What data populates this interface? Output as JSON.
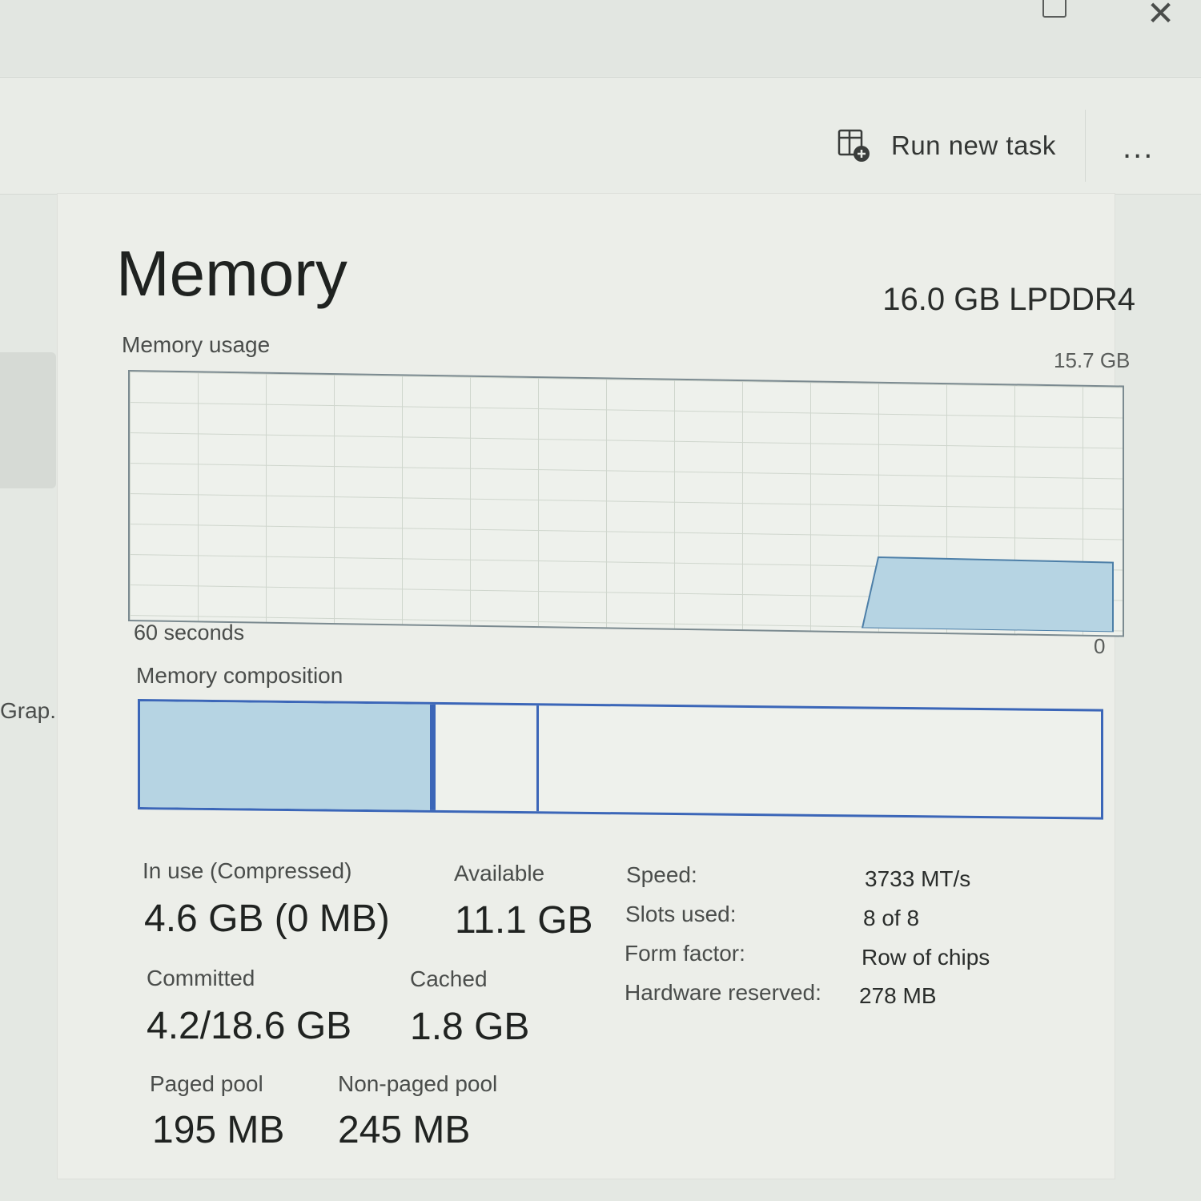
{
  "toolbar": {
    "run_new_task_label": "Run new task",
    "more_label": "..."
  },
  "sidebar": {
    "partial_item_label": "Grap..."
  },
  "memory": {
    "title": "Memory",
    "type": "16.0 GB LPDDR4",
    "usage": {
      "label": "Memory usage",
      "max_label": "15.7 GB",
      "time_span_label": "60 seconds",
      "min_label": "0",
      "recent_fraction": 0.29
    },
    "composition": {
      "label": "Memory composition",
      "in_use_fraction": 0.3,
      "standby_fraction": 0.11
    },
    "stats": {
      "in_use_label": "In use (Compressed)",
      "in_use_value": "4.6 GB (0 MB)",
      "available_label": "Available",
      "available_value": "11.1 GB",
      "committed_label": "Committed",
      "committed_value": "4.2/18.6 GB",
      "cached_label": "Cached",
      "cached_value": "1.8 GB",
      "paged_pool_label": "Paged pool",
      "paged_pool_value": "195 MB",
      "non_paged_pool_label": "Non-paged pool",
      "non_paged_pool_value": "245 MB"
    },
    "specs": {
      "speed_label": "Speed:",
      "speed_value": "3733 MT/s",
      "slots_label": "Slots used:",
      "slots_value": "8 of 8",
      "form_factor_label": "Form factor:",
      "form_factor_value": "Row of chips",
      "hw_reserved_label": "Hardware reserved:",
      "hw_reserved_value": "278 MB"
    }
  },
  "colors": {
    "accent": "#3b66b8",
    "fill": "#b6d4e3"
  }
}
